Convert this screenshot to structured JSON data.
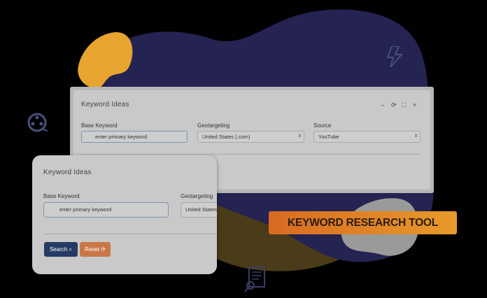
{
  "colors": {
    "background": "#010101",
    "blob_navy": "#242352",
    "blob_mustard": "#4a3b19",
    "blob_orange": "#e7a52f",
    "panel_bg": "#c9c9c9",
    "search_button": "#263b63",
    "reset_button": "#c87846",
    "badge_gradient_start": "#d76b21",
    "badge_gradient_end": "#e89a2a"
  },
  "back_panel": {
    "title": "Keyword Ideas",
    "controls": [
      "–",
      "⟳",
      "⛶",
      "×"
    ],
    "base_keyword": {
      "label": "Base Keyword",
      "placeholder": "enter primary keyword"
    },
    "geotargeting": {
      "label": "Geotargeting",
      "value": "United States (.com)"
    },
    "source": {
      "label": "Source",
      "value": "YouTube"
    }
  },
  "front_panel": {
    "title": "Keyword Ideas",
    "base_keyword": {
      "label": "Base Keyword",
      "placeholder": "enter primary keyword"
    },
    "geotargeting": {
      "label": "Geotargeting",
      "value": "United States"
    },
    "search_button": "Search",
    "reset_button": "Reset",
    "search_icon": "search-icon",
    "reset_icon": "refresh-icon"
  },
  "badge": {
    "text": "KEYWORD RESEARCH TOOL"
  },
  "icons": [
    "film-reel-icon",
    "lightning-bolt-icon",
    "document-search-icon"
  ]
}
